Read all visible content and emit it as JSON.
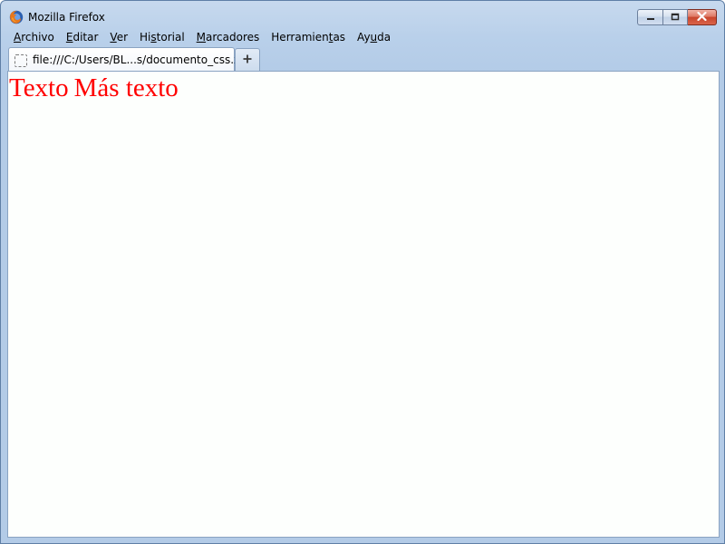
{
  "window": {
    "title": "Mozilla Firefox",
    "icons": {
      "app": "firefox-icon",
      "minimize": "minimize-icon",
      "maximize": "maximize-icon",
      "close": "close-icon"
    }
  },
  "menubar": {
    "items": [
      {
        "label_pre": "",
        "accel": "A",
        "label_post": "rchivo"
      },
      {
        "label_pre": "",
        "accel": "E",
        "label_post": "ditar"
      },
      {
        "label_pre": "",
        "accel": "V",
        "label_post": "er"
      },
      {
        "label_pre": "Hi",
        "accel": "s",
        "label_post": "torial"
      },
      {
        "label_pre": "",
        "accel": "M",
        "label_post": "arcadores"
      },
      {
        "label_pre": "Herramien",
        "accel": "t",
        "label_post": "as"
      },
      {
        "label_pre": "Ay",
        "accel": "u",
        "label_post": "da"
      }
    ]
  },
  "tabs": [
    {
      "title": "file:///C:/Users/BL...s/documento_css.xml",
      "icon": "blank-page-icon",
      "active": true
    }
  ],
  "new_tab": {
    "label": "+",
    "icon": "plus-icon"
  },
  "document": {
    "spans": [
      "Texto",
      "Más texto"
    ],
    "color": "#ff0000"
  },
  "colors": {
    "chrome": "#b9d0ea",
    "close_button": "#c8452c",
    "content_bg": "#fdfffd"
  }
}
